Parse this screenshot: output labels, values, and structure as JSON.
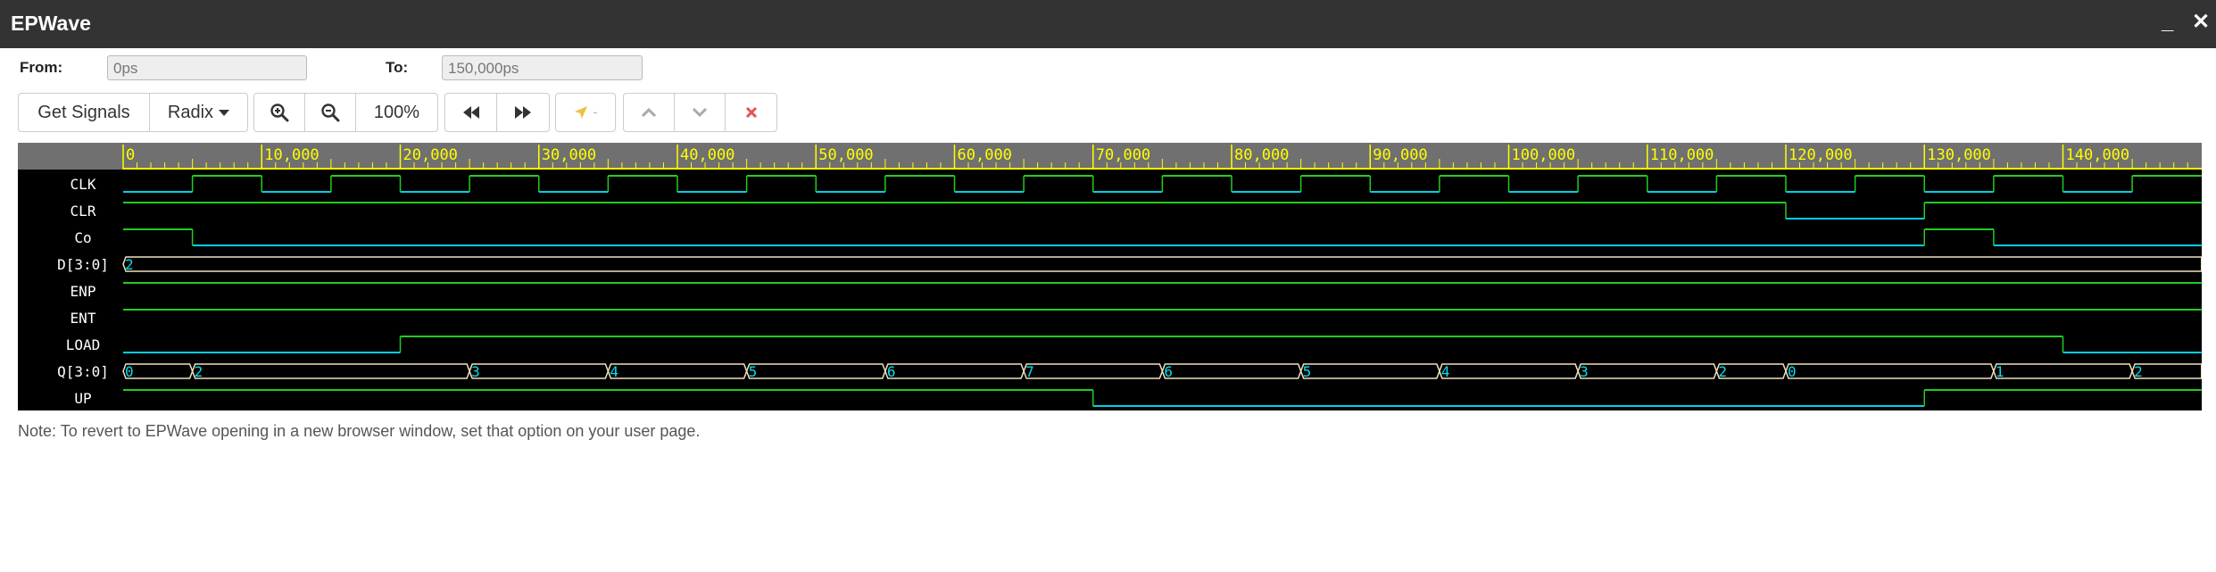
{
  "window": {
    "title": "EPWave",
    "minimize_glyph": "_",
    "close_glyph": "✕"
  },
  "range": {
    "from_label": "From:",
    "from_value": "0ps",
    "to_label": "To:",
    "to_value": "150,000ps"
  },
  "toolbar": {
    "get_signals": "Get Signals",
    "radix": "Radix",
    "zoom_in_icon": "zoom-in-icon",
    "zoom_out_icon": "zoom-out-icon",
    "zoom_level": "100%",
    "prev_edge_icon": "fast-backward-icon",
    "next_edge_icon": "fast-forward-icon",
    "cursor_label": "-",
    "move_up_icon": "chevron-up-icon",
    "move_down_icon": "chevron-down-icon",
    "remove_icon": "close-icon"
  },
  "waveform": {
    "time_unit": "ps",
    "time_ticks": [
      "0",
      "10,000",
      "20,000",
      "30,000",
      "40,000",
      "50,000",
      "60,000",
      "70,000",
      "80,000",
      "90,000",
      "100,000",
      "110,000",
      "120,000",
      "130,000",
      "140,000"
    ],
    "signals": [
      {
        "name": "CLK"
      },
      {
        "name": "CLR"
      },
      {
        "name": "Co"
      },
      {
        "name": "D[3:0]"
      },
      {
        "name": "ENP"
      },
      {
        "name": "ENT"
      },
      {
        "name": "LOAD"
      },
      {
        "name": "Q[3:0]"
      },
      {
        "name": "UP"
      }
    ],
    "bus_values": {
      "D[3:0]": [
        {
          "t": 0,
          "v": "2"
        }
      ],
      "Q[3:0]": [
        {
          "t": 0,
          "v": "0"
        },
        {
          "t": 5000,
          "v": "2"
        },
        {
          "t": 25000,
          "v": "3"
        },
        {
          "t": 35000,
          "v": "4"
        },
        {
          "t": 45000,
          "v": "5"
        },
        {
          "t": 55000,
          "v": "6"
        },
        {
          "t": 65000,
          "v": "7"
        },
        {
          "t": 75000,
          "v": "6"
        },
        {
          "t": 85000,
          "v": "5"
        },
        {
          "t": 95000,
          "v": "4"
        },
        {
          "t": 105000,
          "v": "3"
        },
        {
          "t": 115000,
          "v": "2"
        },
        {
          "t": 120000,
          "v": "0"
        },
        {
          "t": 135000,
          "v": "1"
        },
        {
          "t": 145000,
          "v": "2"
        }
      ]
    },
    "colors": {
      "background": "#000000",
      "high": "#22cc22",
      "low": "#00d0e8",
      "bus": "#f0e0c0",
      "bus_text": "#00e0f0",
      "ruler": "#707070",
      "ruler_text": "#ffff00",
      "label": "#ffffff"
    }
  },
  "note": "Note: To revert to EPWave opening in a new browser window, set that option on your user page."
}
